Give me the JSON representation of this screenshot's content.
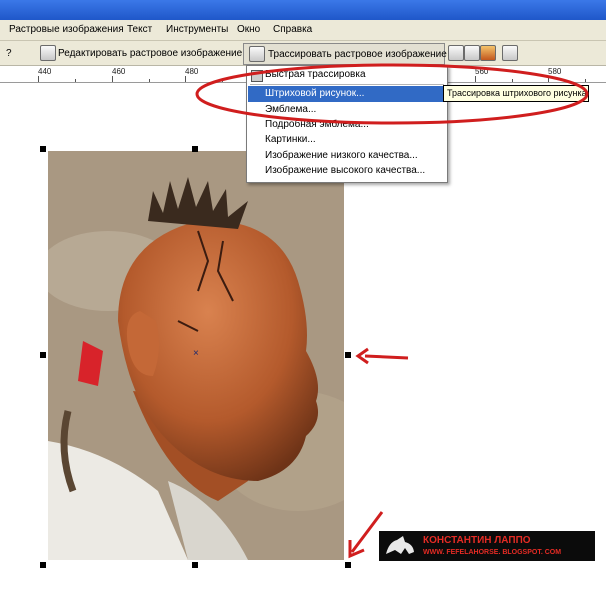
{
  "colors": {
    "title_bar": "#2a66d9",
    "menu_highlight": "#316ac5",
    "annotation_red": "#d01e1e",
    "tooltip_bg": "#ffffe1"
  },
  "menubar": {
    "items": [
      "Растровые изображения",
      "Текст",
      "Инструменты",
      "Окно",
      "Справка"
    ]
  },
  "toolbar": {
    "edit_bitmap_label": "Редактировать растровое изображение...",
    "trace_bitmap_label": "Трассировать растровое изображение",
    "icons": [
      "question-icon",
      "edit-bitmap-icon",
      "trace-bitmap-icon",
      "toolbar-tool-icon",
      "toolbar-tool-icon",
      "toolbar-tool-icon",
      "toolbar-tool-icon"
    ]
  },
  "ruler": {
    "labels": [
      "440",
      "460",
      "480",
      "560",
      "580"
    ]
  },
  "trace_menu": {
    "items": [
      {
        "label": "Быстрая трассировка",
        "highlighted": false
      },
      {
        "label": "Штриховой рисунок...",
        "highlighted": true
      },
      {
        "label": "Эмблема...",
        "highlighted": false
      },
      {
        "label": "Подробная эмблема...",
        "highlighted": false
      },
      {
        "label": "Картинки...",
        "highlighted": false
      },
      {
        "label": "Изображение низкого качества...",
        "highlighted": false
      },
      {
        "label": "Изображение высокого качества...",
        "highlighted": false
      }
    ]
  },
  "tooltip": {
    "text": "Трассировка штрихового рисунка"
  },
  "signature": {
    "name": "КОНСТАНТИН ЛАППО",
    "url": "WWW. FEFELAHORSE. BLOGSPOT. COM"
  }
}
